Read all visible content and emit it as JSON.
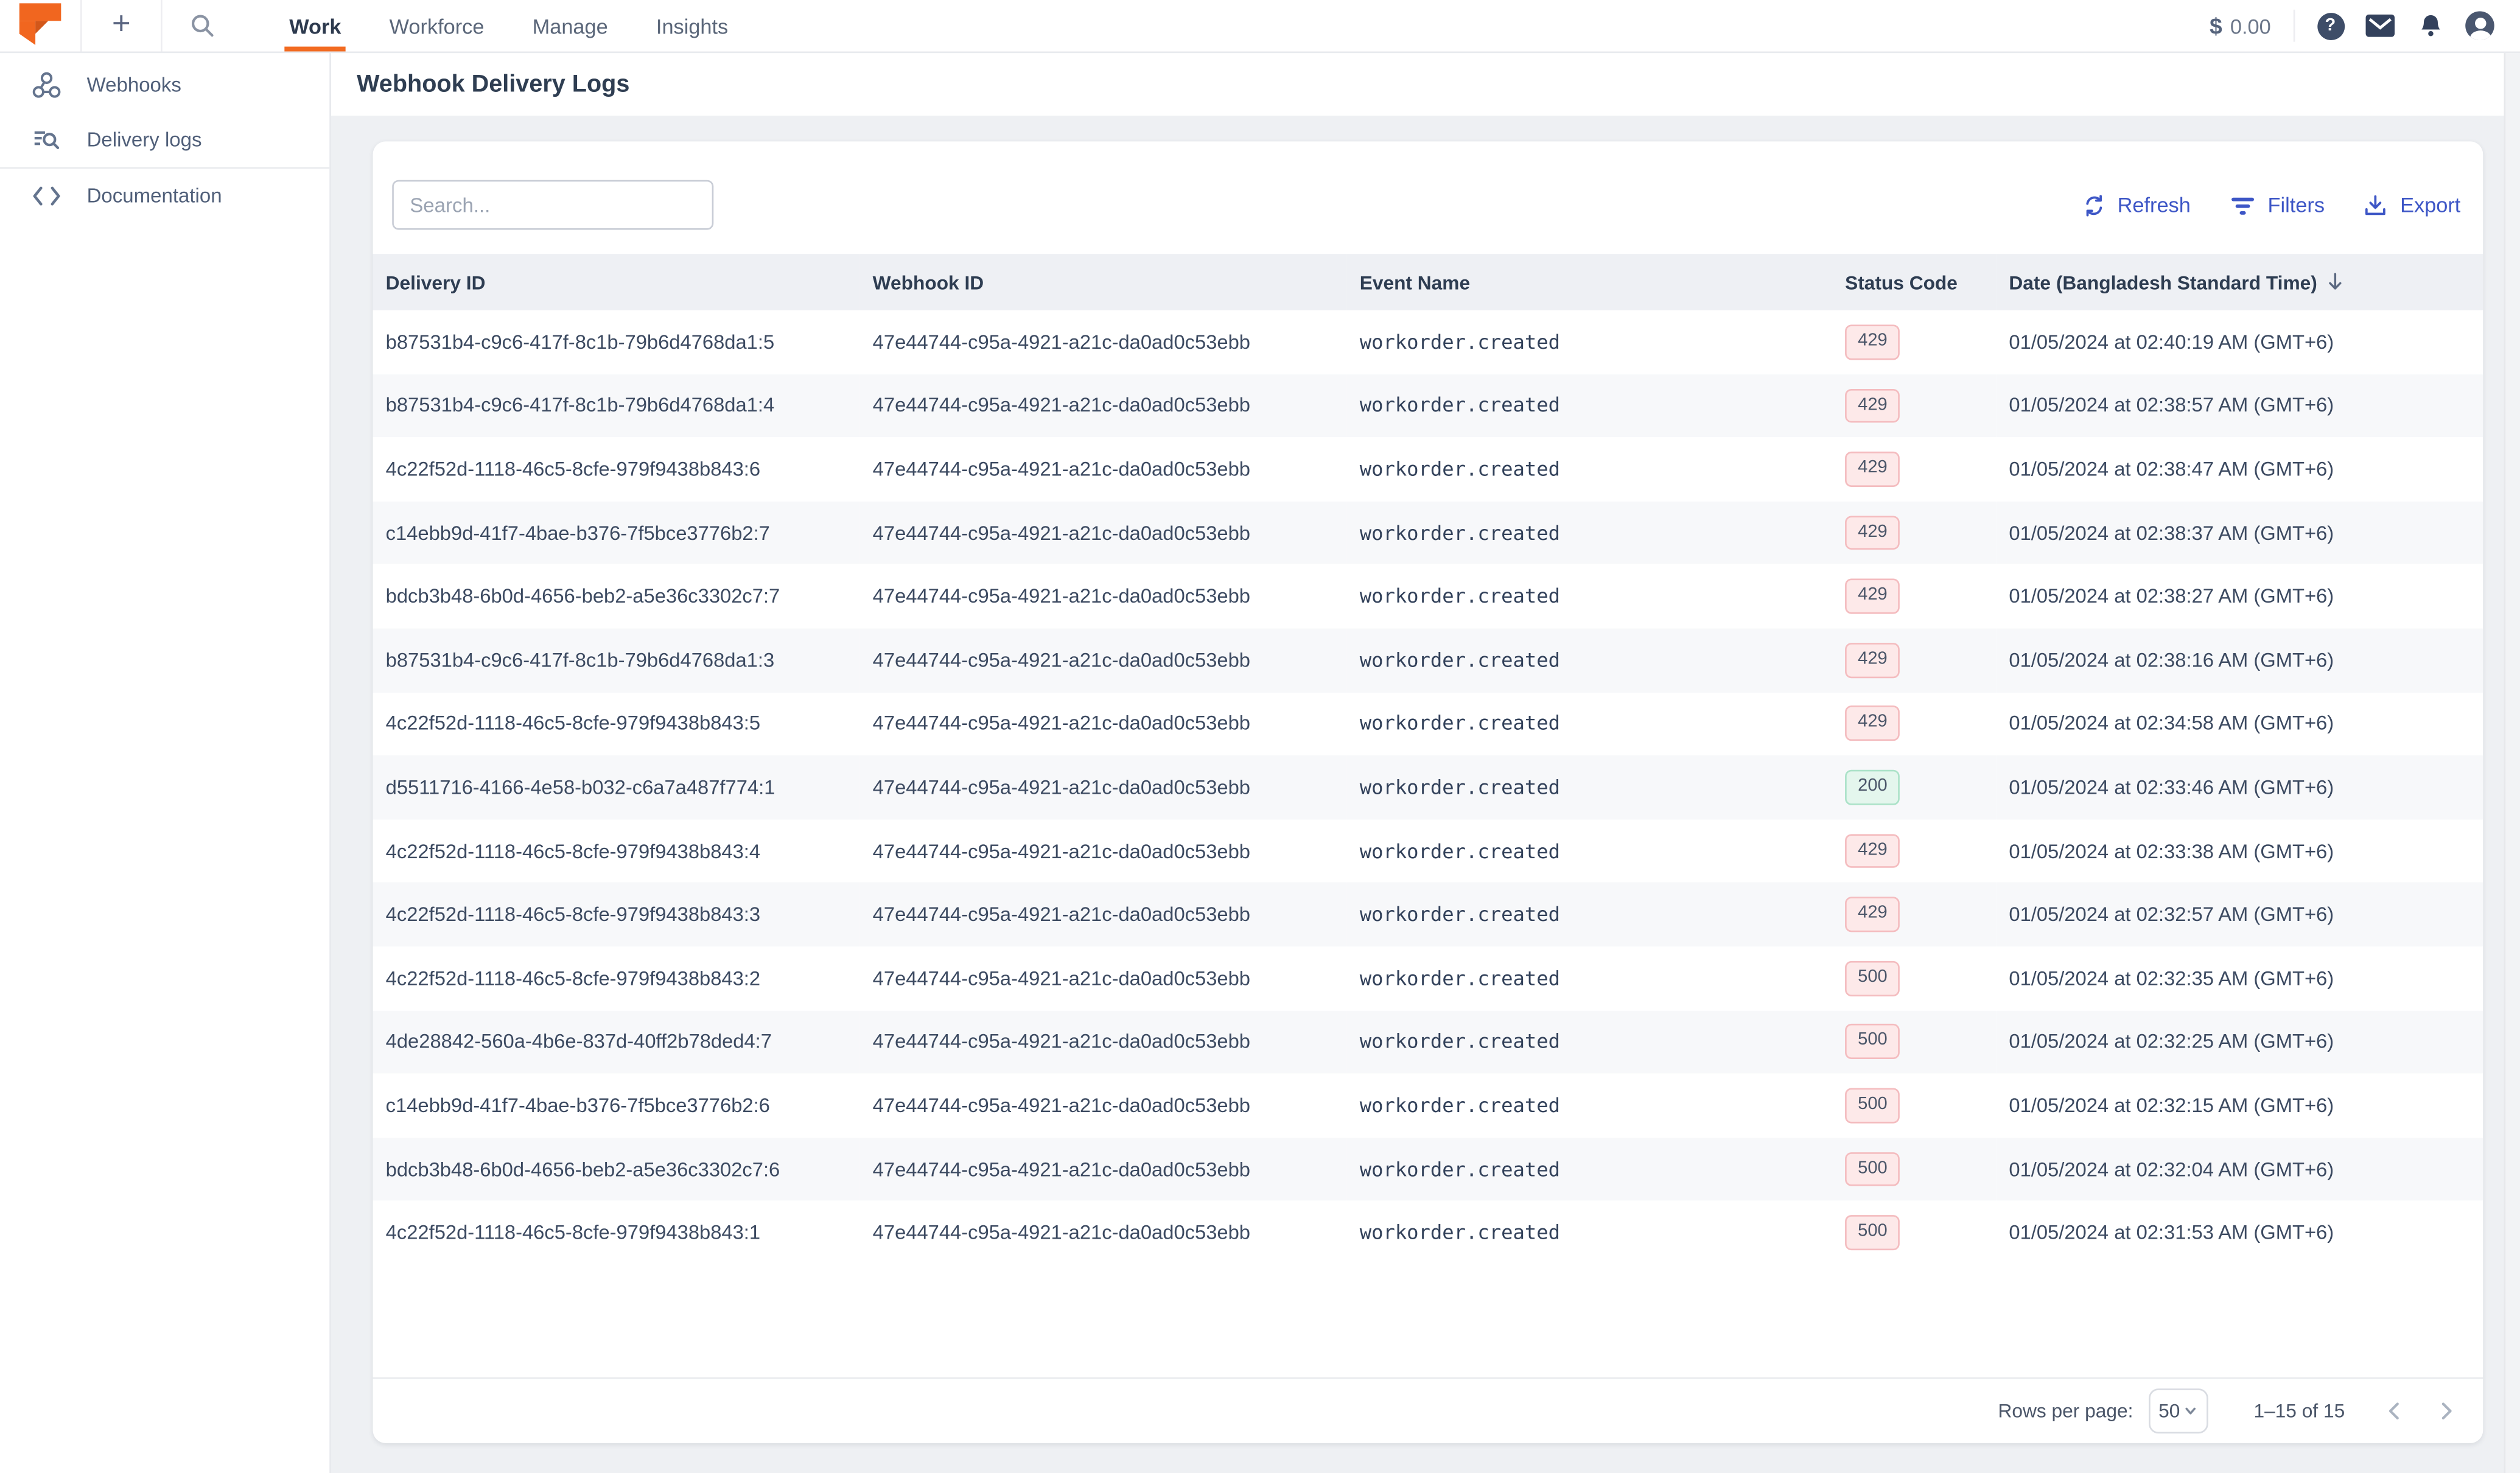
{
  "topbar": {
    "nav": [
      {
        "label": "Work",
        "active": true
      },
      {
        "label": "Workforce",
        "active": false
      },
      {
        "label": "Manage",
        "active": false
      },
      {
        "label": "Insights",
        "active": false
      }
    ],
    "currency_symbol": "$",
    "balance": "0.00",
    "help_glyph": "?"
  },
  "sidebar": {
    "items": [
      {
        "label": "Webhooks",
        "icon": "webhook-icon"
      },
      {
        "label": "Delivery logs",
        "icon": "delivery-logs-icon"
      },
      {
        "label": "Documentation",
        "icon": "code-icon"
      }
    ]
  },
  "page": {
    "title": "Webhook Delivery Logs"
  },
  "toolbar": {
    "search_placeholder": "Search...",
    "refresh_label": "Refresh",
    "filters_label": "Filters",
    "export_label": "Export"
  },
  "table": {
    "columns": [
      "Delivery ID",
      "Webhook ID",
      "Event Name",
      "Status Code",
      "Date (Bangladesh Standard Time)"
    ],
    "rows": [
      {
        "delivery_id": "b87531b4-c9c6-417f-8c1b-79b6d4768da1:5",
        "webhook_id": "47e44744-c95a-4921-a21c-da0ad0c53ebb",
        "event": "workorder.created",
        "status": "429",
        "status_type": "error",
        "date": "01/05/2024 at 02:40:19 AM (GMT+6)"
      },
      {
        "delivery_id": "b87531b4-c9c6-417f-8c1b-79b6d4768da1:4",
        "webhook_id": "47e44744-c95a-4921-a21c-da0ad0c53ebb",
        "event": "workorder.created",
        "status": "429",
        "status_type": "error",
        "date": "01/05/2024 at 02:38:57 AM (GMT+6)"
      },
      {
        "delivery_id": "4c22f52d-1118-46c5-8cfe-979f9438b843:6",
        "webhook_id": "47e44744-c95a-4921-a21c-da0ad0c53ebb",
        "event": "workorder.created",
        "status": "429",
        "status_type": "error",
        "date": "01/05/2024 at 02:38:47 AM (GMT+6)"
      },
      {
        "delivery_id": "c14ebb9d-41f7-4bae-b376-7f5bce3776b2:7",
        "webhook_id": "47e44744-c95a-4921-a21c-da0ad0c53ebb",
        "event": "workorder.created",
        "status": "429",
        "status_type": "error",
        "date": "01/05/2024 at 02:38:37 AM (GMT+6)"
      },
      {
        "delivery_id": "bdcb3b48-6b0d-4656-beb2-a5e36c3302c7:7",
        "webhook_id": "47e44744-c95a-4921-a21c-da0ad0c53ebb",
        "event": "workorder.created",
        "status": "429",
        "status_type": "error",
        "date": "01/05/2024 at 02:38:27 AM (GMT+6)"
      },
      {
        "delivery_id": "b87531b4-c9c6-417f-8c1b-79b6d4768da1:3",
        "webhook_id": "47e44744-c95a-4921-a21c-da0ad0c53ebb",
        "event": "workorder.created",
        "status": "429",
        "status_type": "error",
        "date": "01/05/2024 at 02:38:16 AM (GMT+6)"
      },
      {
        "delivery_id": "4c22f52d-1118-46c5-8cfe-979f9438b843:5",
        "webhook_id": "47e44744-c95a-4921-a21c-da0ad0c53ebb",
        "event": "workorder.created",
        "status": "429",
        "status_type": "error",
        "date": "01/05/2024 at 02:34:58 AM (GMT+6)"
      },
      {
        "delivery_id": "d5511716-4166-4e58-b032-c6a7a487f774:1",
        "webhook_id": "47e44744-c95a-4921-a21c-da0ad0c53ebb",
        "event": "workorder.created",
        "status": "200",
        "status_type": "success",
        "date": "01/05/2024 at 02:33:46 AM (GMT+6)"
      },
      {
        "delivery_id": "4c22f52d-1118-46c5-8cfe-979f9438b843:4",
        "webhook_id": "47e44744-c95a-4921-a21c-da0ad0c53ebb",
        "event": "workorder.created",
        "status": "429",
        "status_type": "error",
        "date": "01/05/2024 at 02:33:38 AM (GMT+6)"
      },
      {
        "delivery_id": "4c22f52d-1118-46c5-8cfe-979f9438b843:3",
        "webhook_id": "47e44744-c95a-4921-a21c-da0ad0c53ebb",
        "event": "workorder.created",
        "status": "429",
        "status_type": "error",
        "date": "01/05/2024 at 02:32:57 AM (GMT+6)"
      },
      {
        "delivery_id": "4c22f52d-1118-46c5-8cfe-979f9438b843:2",
        "webhook_id": "47e44744-c95a-4921-a21c-da0ad0c53ebb",
        "event": "workorder.created",
        "status": "500",
        "status_type": "error",
        "date": "01/05/2024 at 02:32:35 AM (GMT+6)"
      },
      {
        "delivery_id": "4de28842-560a-4b6e-837d-40ff2b78ded4:7",
        "webhook_id": "47e44744-c95a-4921-a21c-da0ad0c53ebb",
        "event": "workorder.created",
        "status": "500",
        "status_type": "error",
        "date": "01/05/2024 at 02:32:25 AM (GMT+6)"
      },
      {
        "delivery_id": "c14ebb9d-41f7-4bae-b376-7f5bce3776b2:6",
        "webhook_id": "47e44744-c95a-4921-a21c-da0ad0c53ebb",
        "event": "workorder.created",
        "status": "500",
        "status_type": "error",
        "date": "01/05/2024 at 02:32:15 AM (GMT+6)"
      },
      {
        "delivery_id": "bdcb3b48-6b0d-4656-beb2-a5e36c3302c7:6",
        "webhook_id": "47e44744-c95a-4921-a21c-da0ad0c53ebb",
        "event": "workorder.created",
        "status": "500",
        "status_type": "error",
        "date": "01/05/2024 at 02:32:04 AM (GMT+6)"
      },
      {
        "delivery_id": "4c22f52d-1118-46c5-8cfe-979f9438b843:1",
        "webhook_id": "47e44744-c95a-4921-a21c-da0ad0c53ebb",
        "event": "workorder.created",
        "status": "500",
        "status_type": "error",
        "date": "01/05/2024 at 02:31:53 AM (GMT+6)"
      }
    ]
  },
  "pagination": {
    "rows_per_page_label": "Rows per page:",
    "rows_per_page_value": "50",
    "range": "1–15 of 15"
  },
  "colors": {
    "accent_orange": "#f26b21",
    "accent_blue": "#3d56c6",
    "badge_error_bg": "#fde9e9",
    "badge_error_border": "#f4bcbf",
    "badge_success_bg": "#e4f6ed",
    "badge_success_border": "#abe2c8",
    "page_bg": "#eef0f3",
    "header_row_bg": "#eef0f4"
  }
}
